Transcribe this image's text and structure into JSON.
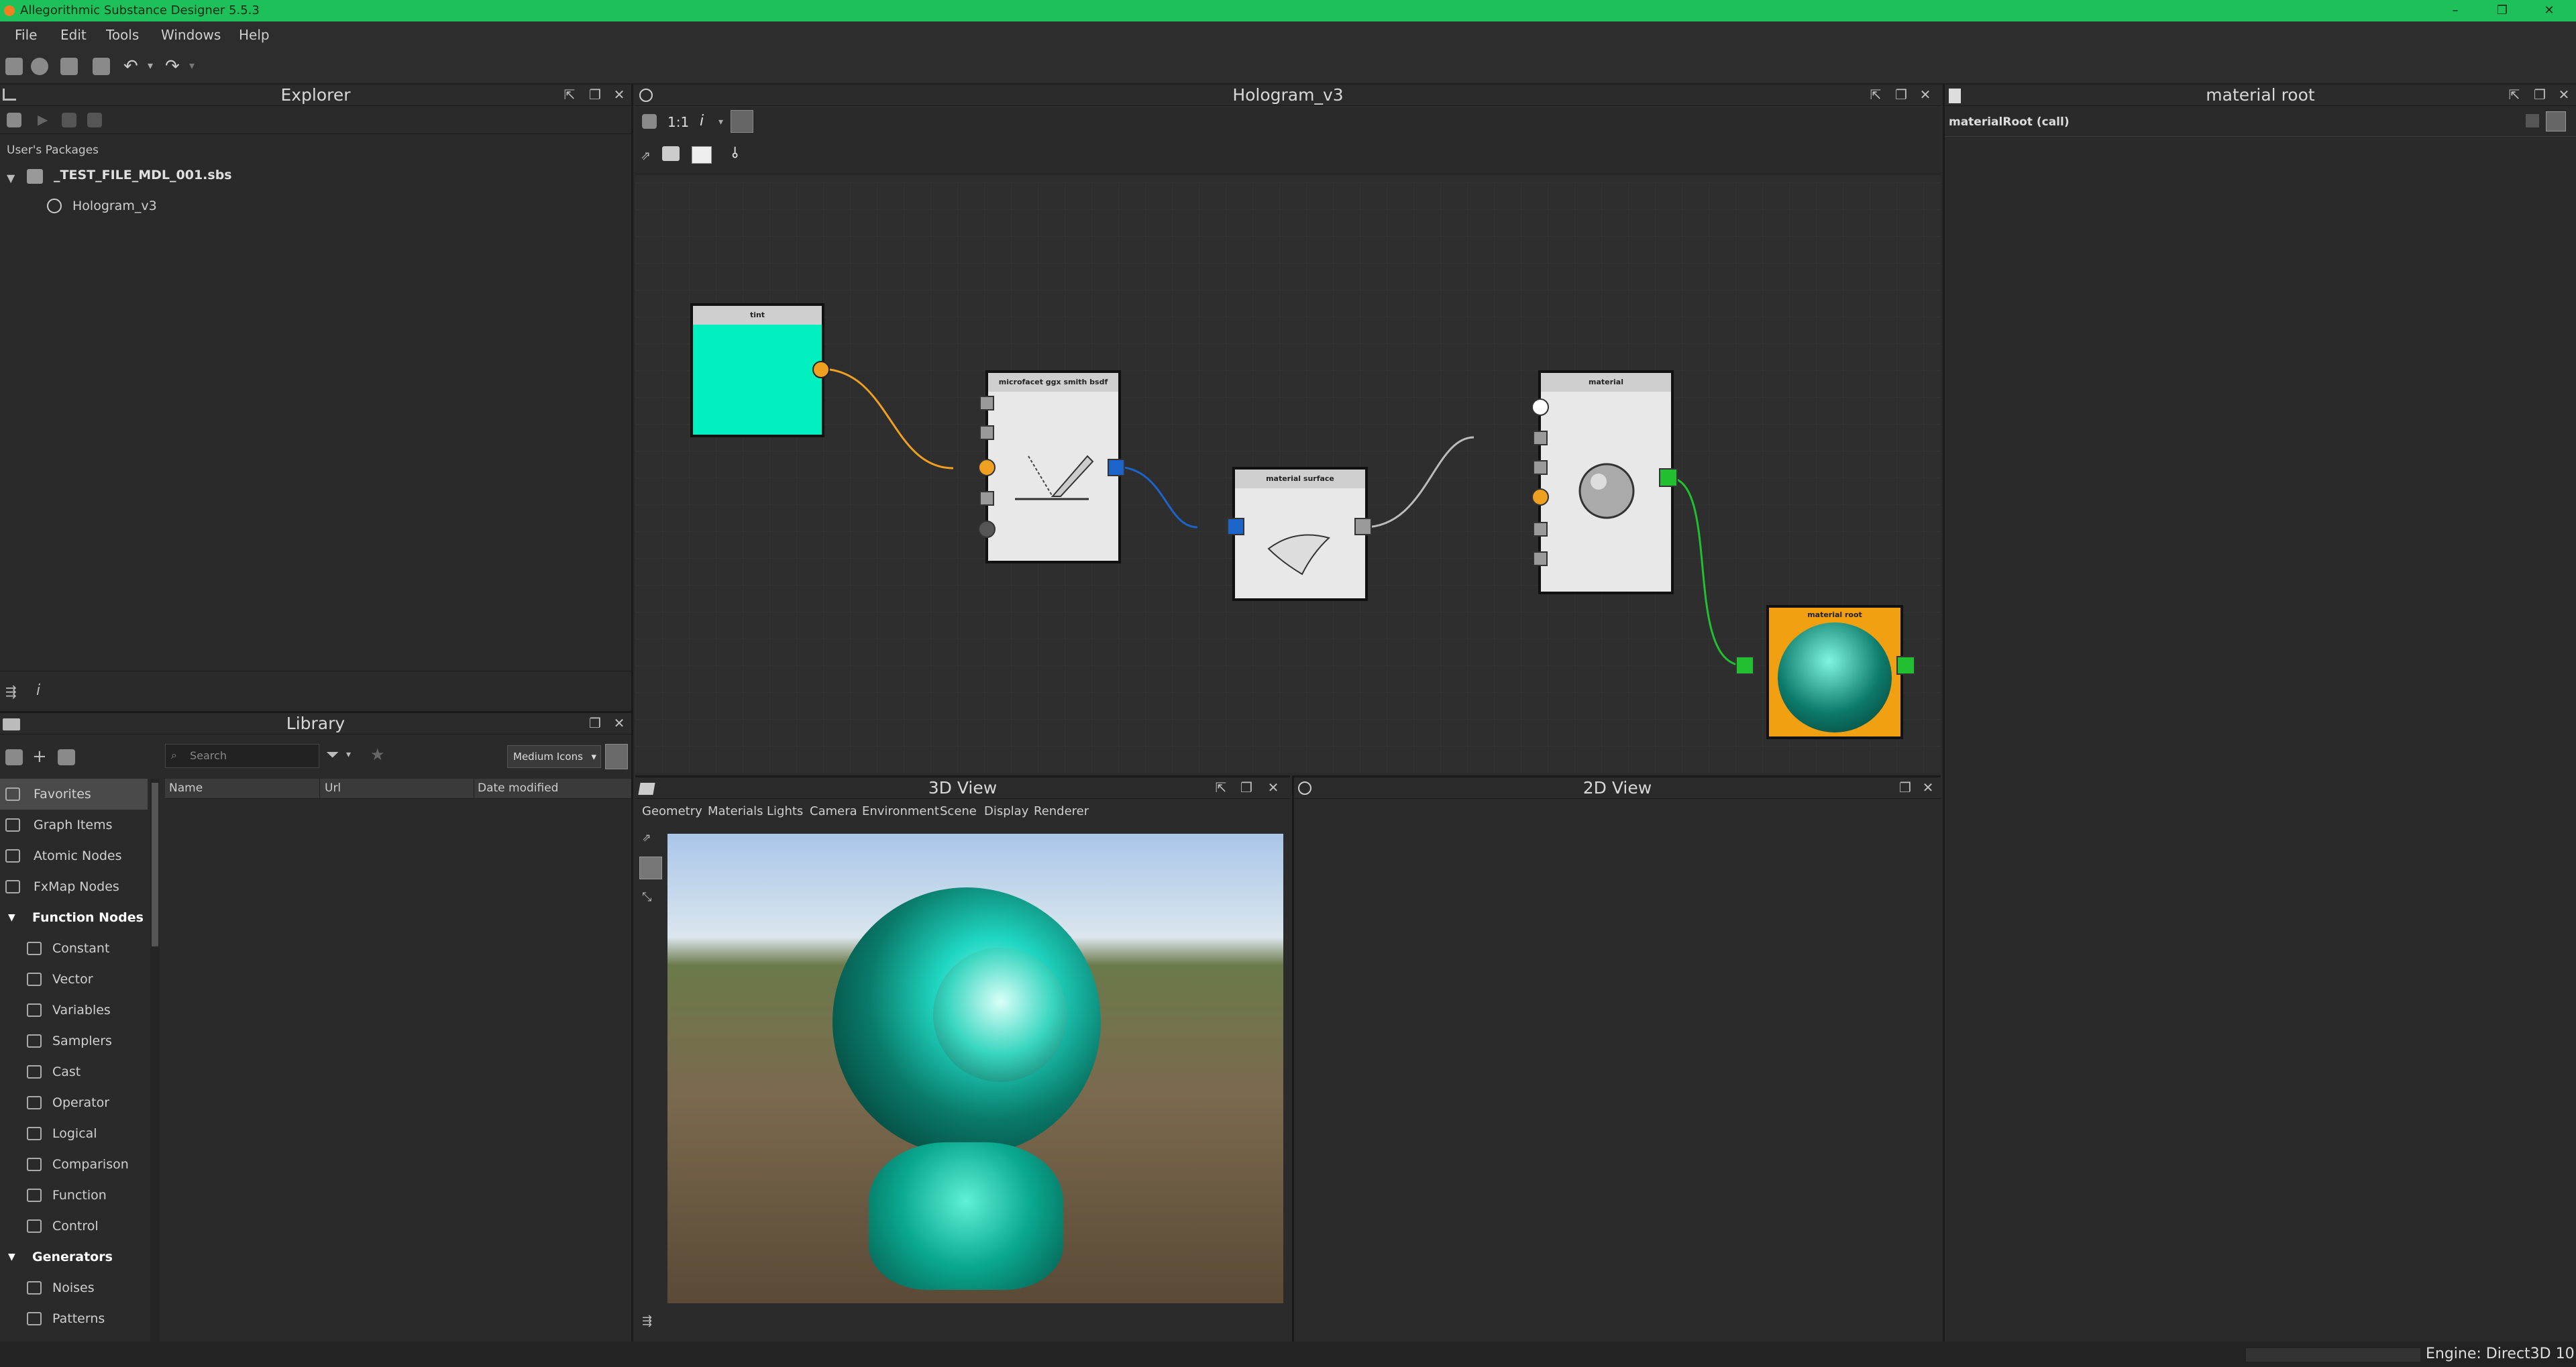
{
  "app": {
    "title": "Allegorithmic Substance Designer 5.5.3"
  },
  "menu": [
    "File",
    "Edit",
    "Tools",
    "Windows",
    "Help"
  ],
  "explorer": {
    "title": "Explorer",
    "section": "User's Packages",
    "package": "_TEST_FILE_MDL_001.sbs",
    "graph": "Hologram_v3"
  },
  "library": {
    "title": "Library",
    "search_placeholder": "Search",
    "view_mode": "Medium Icons",
    "columns": [
      "Name",
      "Url",
      "Date modified"
    ],
    "items": [
      {
        "label": "Favorites",
        "kind": "item",
        "icon": "star-icon"
      },
      {
        "label": "Graph Items",
        "kind": "item",
        "icon": "comment-icon"
      },
      {
        "label": "Atomic Nodes",
        "kind": "item",
        "icon": "nodes-icon"
      },
      {
        "label": "FxMap Nodes",
        "kind": "item",
        "icon": "fxmap-icon"
      },
      {
        "label": "Function Nodes",
        "kind": "category"
      },
      {
        "label": "Constant",
        "kind": "sub",
        "icon": "function-icon"
      },
      {
        "label": "Vector",
        "kind": "sub",
        "icon": "function-icon"
      },
      {
        "label": "Variables",
        "kind": "sub",
        "icon": "function-icon"
      },
      {
        "label": "Samplers",
        "kind": "sub",
        "icon": "function-icon"
      },
      {
        "label": "Cast",
        "kind": "sub",
        "icon": "function-icon"
      },
      {
        "label": "Operator",
        "kind": "sub",
        "icon": "function-icon"
      },
      {
        "label": "Logical",
        "kind": "sub",
        "icon": "function-icon"
      },
      {
        "label": "Comparison",
        "kind": "sub",
        "icon": "function-icon"
      },
      {
        "label": "Function",
        "kind": "sub",
        "icon": "function-icon"
      },
      {
        "label": "Control",
        "kind": "sub",
        "icon": "function-icon"
      },
      {
        "label": "Generators",
        "kind": "category"
      },
      {
        "label": "Noises",
        "kind": "sub",
        "icon": "noise-icon"
      },
      {
        "label": "Patterns",
        "kind": "sub",
        "icon": "pattern-icon"
      }
    ]
  },
  "graph": {
    "title": "Hologram_v3",
    "zoom_label": "1:1",
    "info_label": "i",
    "nodes": {
      "tint": "tint",
      "bsdf": "microfacet ggx smith bsdf",
      "surface": "material surface",
      "material": "material",
      "root": "material root"
    }
  },
  "props": {
    "title": "material root",
    "row": "materialRoot (call)"
  },
  "view3d": {
    "title": "3D View",
    "menu": [
      "Geometry",
      "Materials",
      "Lights",
      "Camera",
      "Environment",
      "Scene",
      "Display",
      "Renderer"
    ]
  },
  "view2d": {
    "title": "2D View"
  },
  "status": {
    "engine": "Engine: Direct3D 10"
  },
  "colors": {
    "accent_green": "#1ec05a",
    "tint_color": "#00f0c0",
    "edge_orange": "#f0a020",
    "edge_blue": "#1d64c8",
    "edge_green": "#20c030",
    "root_orange": "#f0a010"
  }
}
